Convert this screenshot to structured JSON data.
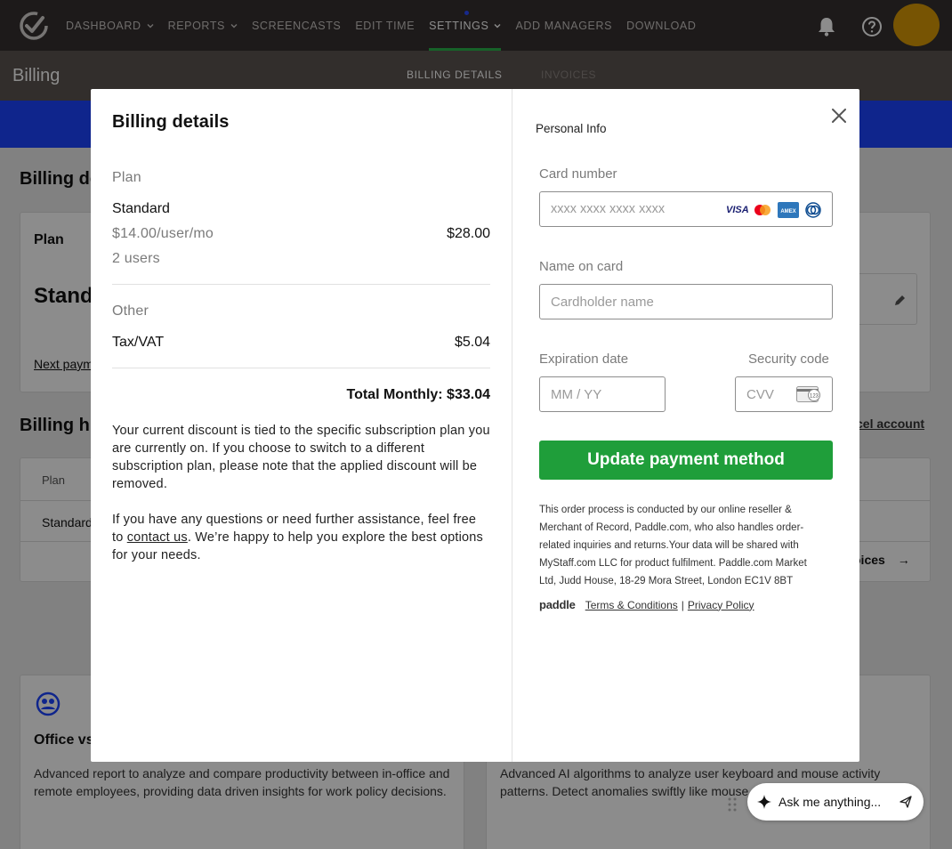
{
  "nav": {
    "items": [
      {
        "label": "DASHBOARD",
        "dropdown": true
      },
      {
        "label": "REPORTS",
        "dropdown": true
      },
      {
        "label": "SCREENCASTS",
        "dropdown": false
      },
      {
        "label": "EDIT TIME",
        "dropdown": false
      },
      {
        "label": "SETTINGS",
        "dropdown": true,
        "active": true
      },
      {
        "label": "ADD MANAGERS",
        "dropdown": false
      },
      {
        "label": "DOWNLOAD",
        "dropdown": false
      }
    ],
    "icons": [
      "bell-icon",
      "help-circle-icon",
      "avatar"
    ]
  },
  "subheader": {
    "title": "Billing",
    "tabs": [
      "BILLING DETAILS",
      "INVOICES"
    ],
    "active_tab": "BILLING DETAILS"
  },
  "background": {
    "billing_details_heading": "Billing de",
    "plan_label": "Plan",
    "plan_value": "Standa",
    "next_payment_link": "Next paym",
    "billing_history_heading": "Billing his",
    "cancel_account_link": "cel account",
    "table_header_plan": "Plan",
    "table_row_plan": "Standard",
    "invoices_link": "oices",
    "office_card_title": "Office vs",
    "office_card_text": "Advanced report to analyze and compare productivity between in-office and remote employees, providing data driven insights for work policy decisions.",
    "ai_card_text": "Advanced AI algorithms to analyze user keyboard and mouse activity patterns. Detect anomalies swiftly like mouse... simulators."
  },
  "modal": {
    "title": "Billing details",
    "plan_section": {
      "label": "Plan",
      "plan_name": "Standard",
      "price_per_user": "$14.00/user/mo",
      "users": "2 users",
      "amount": "$28.00"
    },
    "other_section": {
      "label": "Other",
      "tax_label": "Tax/VAT",
      "tax_amount": "$5.04"
    },
    "total": "Total Monthly: $33.04",
    "discount_note": "Your current discount is tied to the specific subscription plan you are currently on. If you choose to switch to a different subscription plan, please note that the applied discount will be removed.",
    "help_text_before": "If you have any questions or need further assistance, feel free to ",
    "help_link": "contact us",
    "help_text_after": ". We’re happy to help you explore the best options for your needs.",
    "personal_info_heading": "Personal Info",
    "card_number_label": "Card number",
    "card_number_placeholder": "xxxx xxxx xxxx xxxx",
    "card_brands": [
      "VISA",
      "Mastercard",
      "Amex",
      "Diners"
    ],
    "name_label": "Name on card",
    "name_placeholder": "Cardholder name",
    "expiration_label": "Expiration date",
    "expiration_placeholder": "MM / YY",
    "security_label": "Security code",
    "cvv_placeholder": "CVV",
    "cvv_icon_text": "123",
    "update_button": "Update payment method",
    "legal_text": "This order process is conducted by our online reseller & Merchant of Record, Paddle.com, who also handles order-related inquiries and returns.Your data will be shared with MyStaff.com LLC for product fulfilment. Paddle.com Market Ltd, Judd House, 18-29 Mora Street, London EC1V 8BT",
    "paddle_logo": "paddle",
    "terms_link": "Terms & Conditions",
    "separator": "|",
    "privacy_link": "Privacy Policy"
  },
  "assistant": {
    "placeholder": "Ask me anything..."
  },
  "colors": {
    "nav_bg": "#363130",
    "active_underline": "#2bb24c",
    "accent_blue": "#1d44ff",
    "update_button": "#1f9e3a",
    "avatar": "#d99a06"
  }
}
